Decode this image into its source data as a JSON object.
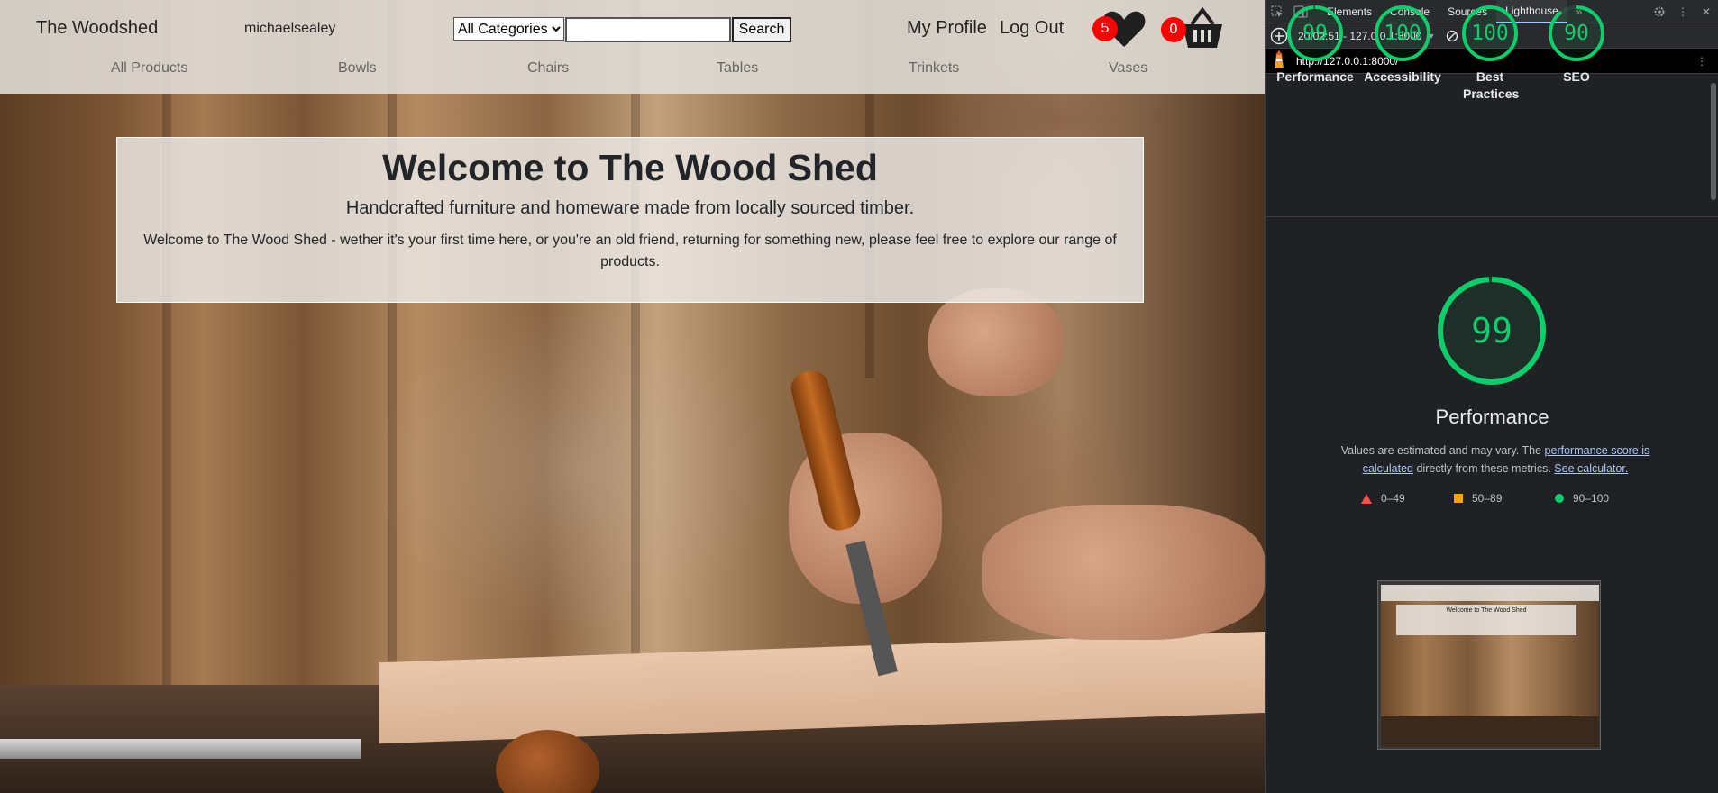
{
  "site": {
    "brand": "The Woodshed",
    "username": "michaelsealey",
    "search": {
      "category_selected": "All Categories",
      "query": "",
      "button": "Search"
    },
    "nav_right": {
      "profile": "My Profile",
      "logout": "Log Out"
    },
    "wishlist_count": "5",
    "basket_count": "0",
    "categories": [
      "All Products",
      "Bowls",
      "Chairs",
      "Tables",
      "Trinkets",
      "Vases"
    ],
    "hero": {
      "title": "Welcome to The Wood Shed",
      "subtitle": "Handcrafted furniture and homeware made from locally sourced timber.",
      "description": "Welcome to The Wood Shed - wether it's your first time here, or you're an old friend, returning for something new, please feel free to explore our range of products."
    }
  },
  "devtools": {
    "tabs": [
      "Elements",
      "Console",
      "Sources",
      "Lighthouse"
    ],
    "active_tab": "Lighthouse",
    "report_selector": "20:02:51 - 127.0.0.1:8000",
    "url": "http://127.0.0.1:8000/",
    "scores": [
      {
        "label": "Performance",
        "value": "99",
        "fraction": 0.99
      },
      {
        "label": "Accessibility",
        "value": "100",
        "fraction": 1.0
      },
      {
        "label": "Best Practices",
        "value": "100",
        "fraction": 1.0
      },
      {
        "label": "SEO",
        "value": "90",
        "fraction": 0.9
      }
    ],
    "performance": {
      "score": "99",
      "fraction": 0.99,
      "title": "Performance",
      "note_prefix": "Values are estimated and may vary. The",
      "note_link1": "performance score is calculated",
      "note_middle": "directly from these metrics.",
      "note_link2": "See calculator."
    },
    "legend": [
      "0–49",
      "50–89",
      "90–100"
    ],
    "thumbnail_title": "Welcome to The Wood Shed",
    "colors": {
      "pass": "#0cce6b",
      "average": "#ffa400",
      "fail": "#ff4e42",
      "badge": "#ff0000"
    }
  }
}
